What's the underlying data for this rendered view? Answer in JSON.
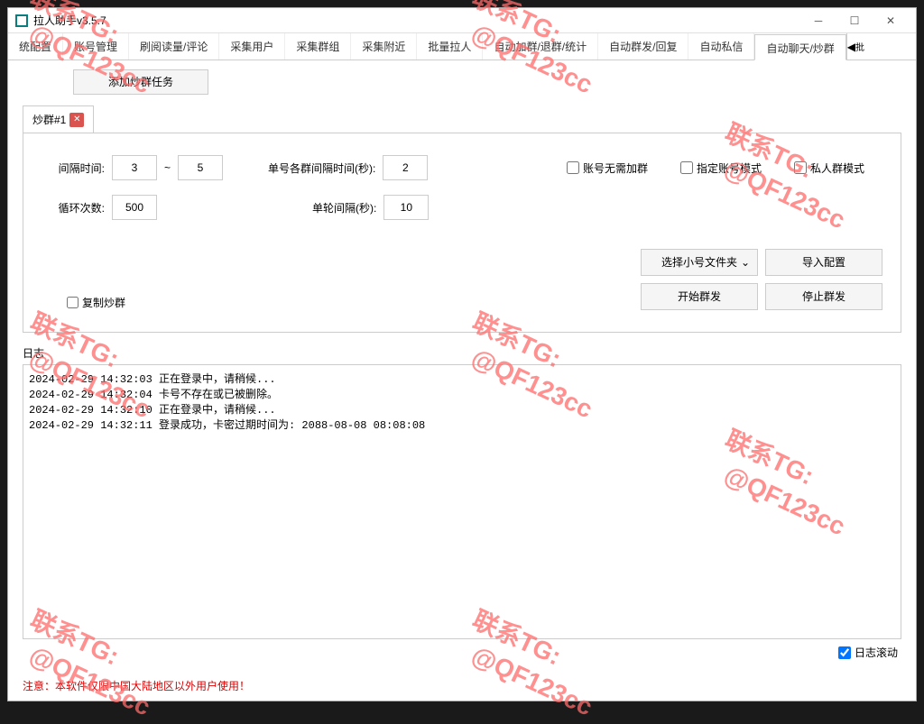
{
  "window_title": "拉人助手v3.5.7",
  "tabs": [
    "统配置",
    "账号管理",
    "刷阅读量/评论",
    "采集用户",
    "采集群组",
    "采集附近",
    "批量拉人",
    "自动加群/退群/统计",
    "自动群发/回复",
    "自动私信",
    "自动聊天/炒群"
  ],
  "active_tab_index": 10,
  "tab_scroll_hint": "批",
  "add_task_label": "添加炒群任务",
  "subtab_label": "炒群#1",
  "form": {
    "interval_label": "间隔时间:",
    "interval_from": "3",
    "interval_to": "5",
    "single_account_interval_label": "单号各群间隔时间(秒):",
    "single_account_interval": "2",
    "loop_count_label": "循环次数:",
    "loop_count": "500",
    "round_interval_label": "单轮间隔(秒):",
    "round_interval": "10"
  },
  "checkboxes": {
    "no_need_add_group": "账号无需加群",
    "specified_account_mode": "指定账号模式",
    "private_group_mode": "私人群模式",
    "copy_group": "复制炒群"
  },
  "buttons": {
    "select_folder": "选择小号文件夹",
    "import_config": "导入配置",
    "start": "开始群发",
    "stop": "停止群发"
  },
  "log_label": "日志",
  "log_lines": [
    "2024-02-29 14:32:03 正在登录中，请稍候...",
    "2024-02-29 14:32:04 卡号不存在或已被删除。",
    "2024-02-29 14:32:10 正在登录中，请稍候...",
    "2024-02-29 14:32:11 登录成功，卡密过期时间为: 2088-08-08 08:08:08"
  ],
  "log_scroll_label": "日志滚动",
  "notice": "注意：本软件仅限中国大陆地区以外用户使用！",
  "watermark": "联系TG:\n  @QF123cc"
}
